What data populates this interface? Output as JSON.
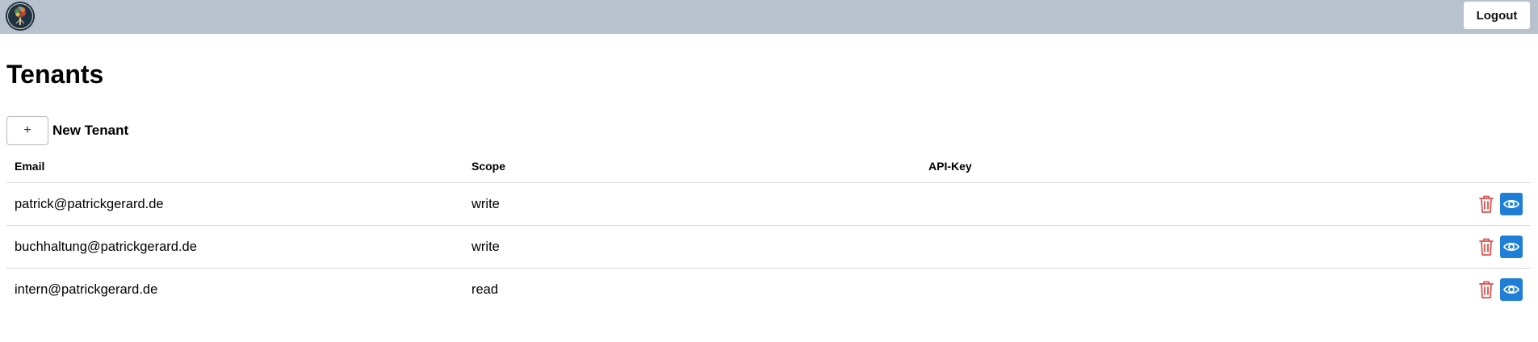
{
  "header": {
    "logo_icon": "tree-logo-icon",
    "logout_label": "Logout",
    "background": "#b7c2ce"
  },
  "page": {
    "title": "Tenants"
  },
  "toolbar": {
    "add_label": "+",
    "new_tenant_label": "New Tenant"
  },
  "table": {
    "columns": [
      "Email",
      "Scope",
      "API-Key"
    ],
    "rows": [
      {
        "email": "patrick@patrickgerard.de",
        "scope": "write",
        "api_key": ""
      },
      {
        "email": "buchhaltung@patrickgerard.de",
        "scope": "write",
        "api_key": ""
      },
      {
        "email": "intern@patrickgerard.de",
        "scope": "read",
        "api_key": ""
      }
    ],
    "delete_icon": "trash-icon",
    "view_icon": "eye-icon",
    "delete_color": "#d9534f",
    "view_color": "#1f7fd6"
  }
}
